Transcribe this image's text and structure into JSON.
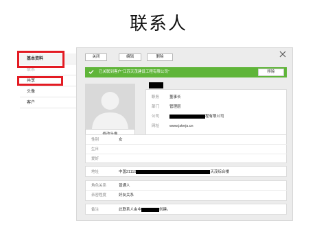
{
  "slide_title": "联系人",
  "sidebar": {
    "items": [
      {
        "label": "基本资料"
      },
      {
        "label": "联系"
      },
      {
        "label": "共享"
      },
      {
        "label": "头像"
      },
      {
        "label": "客户"
      }
    ]
  },
  "toolbar": {
    "close_label": "关闭",
    "edit_label": "编辑",
    "delete_label": "删除"
  },
  "banner": {
    "text": "已关联到客户“江苏天茂建设工程有限公司”",
    "button_label": "移除",
    "color": "#5fb539"
  },
  "avatar": {
    "caption": "修改头像"
  },
  "profile": {
    "fields": [
      {
        "label": "职务",
        "value": "董事长"
      },
      {
        "label": "部门",
        "value": "管理层"
      },
      {
        "label": "公司",
        "value": "程有限公司"
      },
      {
        "label": "网址",
        "value": "www.jstmjs.cn"
      }
    ]
  },
  "section1": {
    "rows": [
      {
        "label": "性别",
        "value": "女"
      },
      {
        "label": "生日",
        "value": ""
      },
      {
        "label": "爱好",
        "value": ""
      }
    ]
  },
  "address": {
    "label": "地址",
    "value_prefix": "中国21110",
    "value_suffix": "天茂综合楼"
  },
  "section3": {
    "rows": [
      {
        "label": "角色关系",
        "value": "普通人"
      },
      {
        "label": "亲密程度",
        "value": "好友关系"
      }
    ]
  },
  "remarks": {
    "label": "备注",
    "value_prefix": "此联系人由中",
    "value_suffix": "创建。"
  }
}
